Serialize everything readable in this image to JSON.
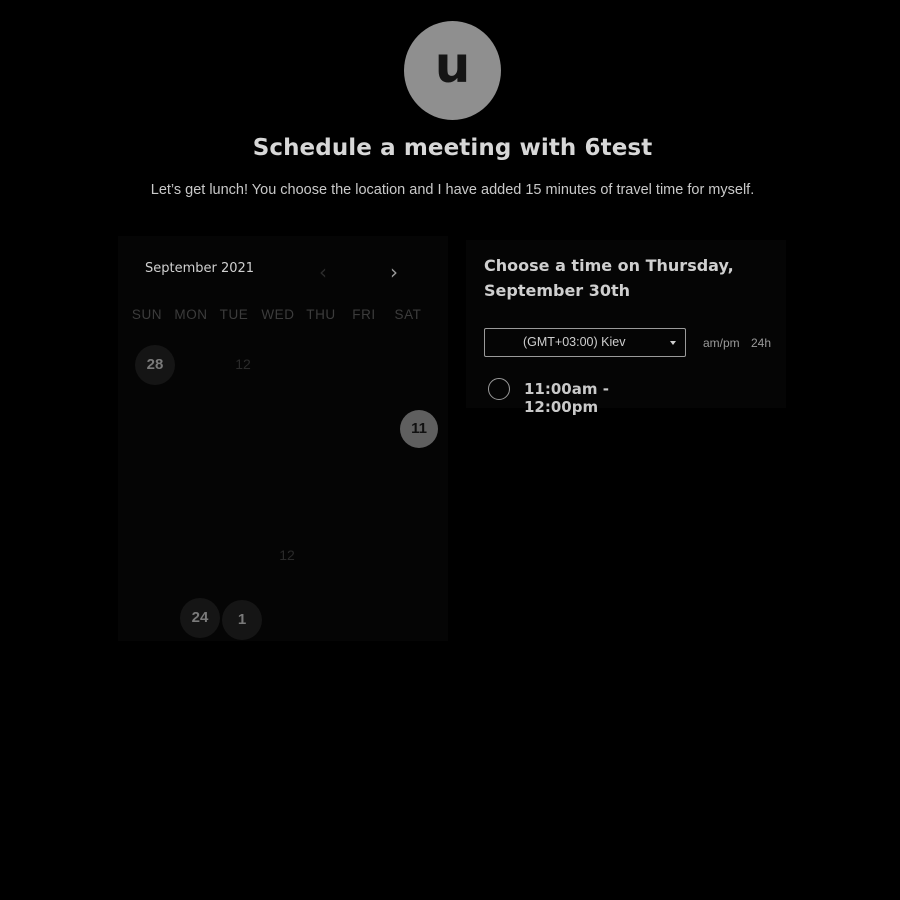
{
  "profile": {
    "avatar_letter": "u"
  },
  "header": {
    "title": "Schedule a meeting with 6test",
    "description": "Let’s get lunch! You choose the location and I have added 15 minutes of travel time for myself."
  },
  "calendar": {
    "month_label": "September 2021",
    "prev_icon": "chevron-left-icon",
    "next_icon": "chevron-right-icon",
    "weekdays": [
      "SUN",
      "MON",
      "TUE",
      "WED",
      "THU",
      "FRI",
      "SAT"
    ],
    "visible_days": [
      {
        "label": "28",
        "state": "available"
      },
      {
        "label": "12",
        "state": "unavailable"
      },
      {
        "label": "11",
        "state": "selected"
      },
      {
        "label": "12",
        "state": "unavailable"
      },
      {
        "label": "24",
        "state": "available"
      },
      {
        "label": "1",
        "state": "available"
      }
    ]
  },
  "time_picker": {
    "heading": "Choose a time on Thursday, September 30th",
    "timezone": "(GMT+03:00) Kiev",
    "format_ampm": "am/pm",
    "format_24h": "24h",
    "slots": [
      {
        "label": "11:00am - 12:00pm"
      }
    ]
  }
}
